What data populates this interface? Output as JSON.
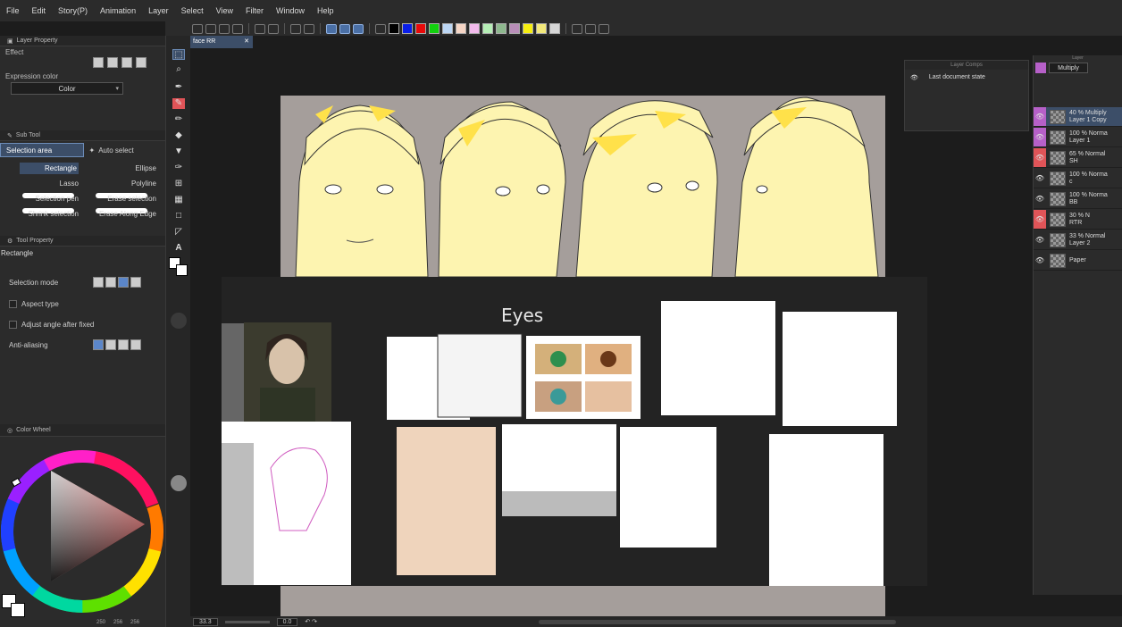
{
  "menu": [
    "File",
    "Edit",
    "Story(P)",
    "Animation",
    "Layer",
    "Select",
    "View",
    "Filter",
    "Window",
    "Help"
  ],
  "colors": {
    "accent": "#3c4e68",
    "accent_border": "#6c8cb8",
    "layer_purple": "#b660c8",
    "layer_red": "#e05458",
    "canvas_bg": "#a59e9b",
    "skin": "#fdf4b0"
  },
  "toolbar": {
    "swatches": [
      "#000000",
      "#0a1ee8",
      "#e80a0a",
      "#12d00e",
      "#bcd6f4",
      "#f6d6c6",
      "#f2baec",
      "#b6eeb6",
      "#8eb88e",
      "#b88eb8",
      "#f6ee10",
      "#f2e87a",
      "#d6d6d6"
    ]
  },
  "layer_property": {
    "title": "Layer Property",
    "effect_label": "Effect",
    "expression_label": "Expression color",
    "expression_value": "Color"
  },
  "sub_tool": {
    "title": "Sub Tool",
    "tabs": [
      "Selection area",
      "Auto select"
    ],
    "tools": [
      "Rectangle",
      "Ellipse",
      "Lasso",
      "Polyline",
      "Selection pen",
      "Erase selection",
      "Shrink selection",
      "Erase Along Edge"
    ]
  },
  "tool_property": {
    "title": "Tool Property",
    "tool_name": "Rectangle",
    "rows": [
      "Selection mode",
      "Aspect type",
      "Adjust angle after fixed",
      "Anti-aliasing"
    ]
  },
  "color_wheel": {
    "title": "Color Wheel",
    "values": [
      "250",
      "256",
      "256"
    ]
  },
  "document": {
    "tab": "face RR",
    "board_title": "Eyes"
  },
  "layer_comps": {
    "title": "Layer Comps",
    "item": "Last document state"
  },
  "layers": {
    "title": "Layer",
    "blend": "Multiply",
    "items": [
      {
        "line1": "40 % Multiply",
        "line2": "Layer 1 Copy",
        "vis": "purple",
        "selected": true
      },
      {
        "line1": "100 % Norma",
        "line2": "Layer 1",
        "vis": "purple",
        "selected": false
      },
      {
        "line1": "65 % Normal",
        "line2": "SH",
        "vis": "red",
        "selected": false
      },
      {
        "line1": "100 % Norma",
        "line2": "c",
        "vis": "none",
        "selected": false
      },
      {
        "line1": "100 % Norma",
        "line2": "BB",
        "vis": "none",
        "selected": false
      },
      {
        "line1": "30 % N",
        "line2": "RTR",
        "vis": "red",
        "selected": false
      },
      {
        "line1": "33 % Normal",
        "line2": "Layer 2",
        "vis": "none",
        "selected": false
      },
      {
        "line1": "",
        "line2": "Paper",
        "vis": "none",
        "selected": false
      }
    ]
  },
  "status": {
    "zoom": "33.3",
    "angle": "0.0"
  }
}
